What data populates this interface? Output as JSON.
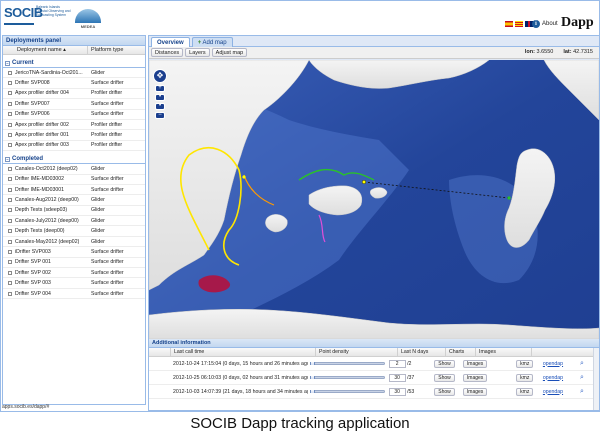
{
  "header": {
    "logo_mark": "SOCIB",
    "logo_subtitle": "Balearic Islands Coastal Observing and Forecasting System",
    "partner_logo": "MEDEA",
    "flags": [
      "spain-flag",
      "catalonia-flag",
      "uk-flag"
    ],
    "about_label": "About",
    "app_name": "Dapp"
  },
  "deployments_panel": {
    "title": "Deployments panel",
    "col_name": "Deployment name ▴",
    "col_type": "Platform type",
    "current": {
      "label": "Current",
      "rows": [
        {
          "name": "JericoTNA-Sardinia-Oct201...",
          "type": "Glider"
        },
        {
          "name": "Drifter SVP008",
          "type": "Surface drifter"
        },
        {
          "name": "Apex profiler drifter 004",
          "type": "Profiler drifter"
        },
        {
          "name": "Drifter SVP007",
          "type": "Surface drifter"
        },
        {
          "name": "Drifter SVP006",
          "type": "Surface drifter"
        },
        {
          "name": "Apex profiler drifter 002",
          "type": "Profiler drifter"
        },
        {
          "name": "Apex profiler drifter 001",
          "type": "Profiler drifter"
        },
        {
          "name": "Apex profiler drifter 003",
          "type": "Profiler drifter"
        }
      ]
    },
    "completed": {
      "label": "Completed",
      "rows": [
        {
          "name": "Canales-Oct2012 (deep02)",
          "type": "Glider"
        },
        {
          "name": "Drifter IME-MD03002",
          "type": "Surface drifter"
        },
        {
          "name": "Drifter IME-MD03001",
          "type": "Surface drifter"
        },
        {
          "name": "Canales-Aug2012 (deep00)",
          "type": "Glider"
        },
        {
          "name": "Depth Tests (sdeep03)",
          "type": "Glider"
        },
        {
          "name": "Canales-July2012 (deep00)",
          "type": "Glider"
        },
        {
          "name": "Depth Tests (deep00)",
          "type": "Glider"
        },
        {
          "name": "Canales-May2012 (deep02)",
          "type": "Glider"
        },
        {
          "name": "iDrifter SVP003",
          "type": "Surface drifter"
        },
        {
          "name": "Drifter SVP 001",
          "type": "Surface drifter"
        },
        {
          "name": "Drifter SVP 002",
          "type": "Surface drifter"
        },
        {
          "name": "Drifter SVP 003",
          "type": "Surface drifter"
        },
        {
          "name": "Drifter SVP 004",
          "type": "Surface drifter"
        }
      ]
    }
  },
  "status_bar": "apps.socib.es/dapp/#",
  "tabs": {
    "overview": "Overview",
    "add_map": "Add map"
  },
  "toolbar": {
    "distances": "Distances",
    "layers": "Layers",
    "adjust_map": "Adjust map",
    "lon_label": "lon:",
    "lon_value": "3.6550",
    "lat_label": "lat:",
    "lat_value": "42.7315"
  },
  "additional_info": {
    "title": "Additional information",
    "columns": [
      "Last call time",
      "Point density",
      "Last N days",
      "Charts",
      "Images"
    ],
    "rows": [
      {
        "last_call": "2012-10-24 17:15:04 (0 days, 15 hours and 26 minutes ago)",
        "density": 0.0,
        "n_days": "2",
        "n_total": "/2",
        "charts": "Show",
        "images": "Images",
        "export": "kmz",
        "link": "opendap"
      },
      {
        "last_call": "2012-10-25 06:10:03 (0 days, 02 hours and 31 minutes ago)",
        "density": 0.0,
        "n_days": "30",
        "n_total": "/37",
        "charts": "Show",
        "images": "Images",
        "export": "kmz",
        "link": "opendap"
      },
      {
        "last_call": "2012-10-03 14:07:39 (21 days, 18 hours and 34 minutes ago)",
        "density": 0.0,
        "n_days": "30",
        "n_total": "/53",
        "charts": "Show",
        "images": "Images",
        "export": "kmz",
        "link": "opendap"
      }
    ]
  },
  "caption": "SOCIB Dapp tracking application"
}
